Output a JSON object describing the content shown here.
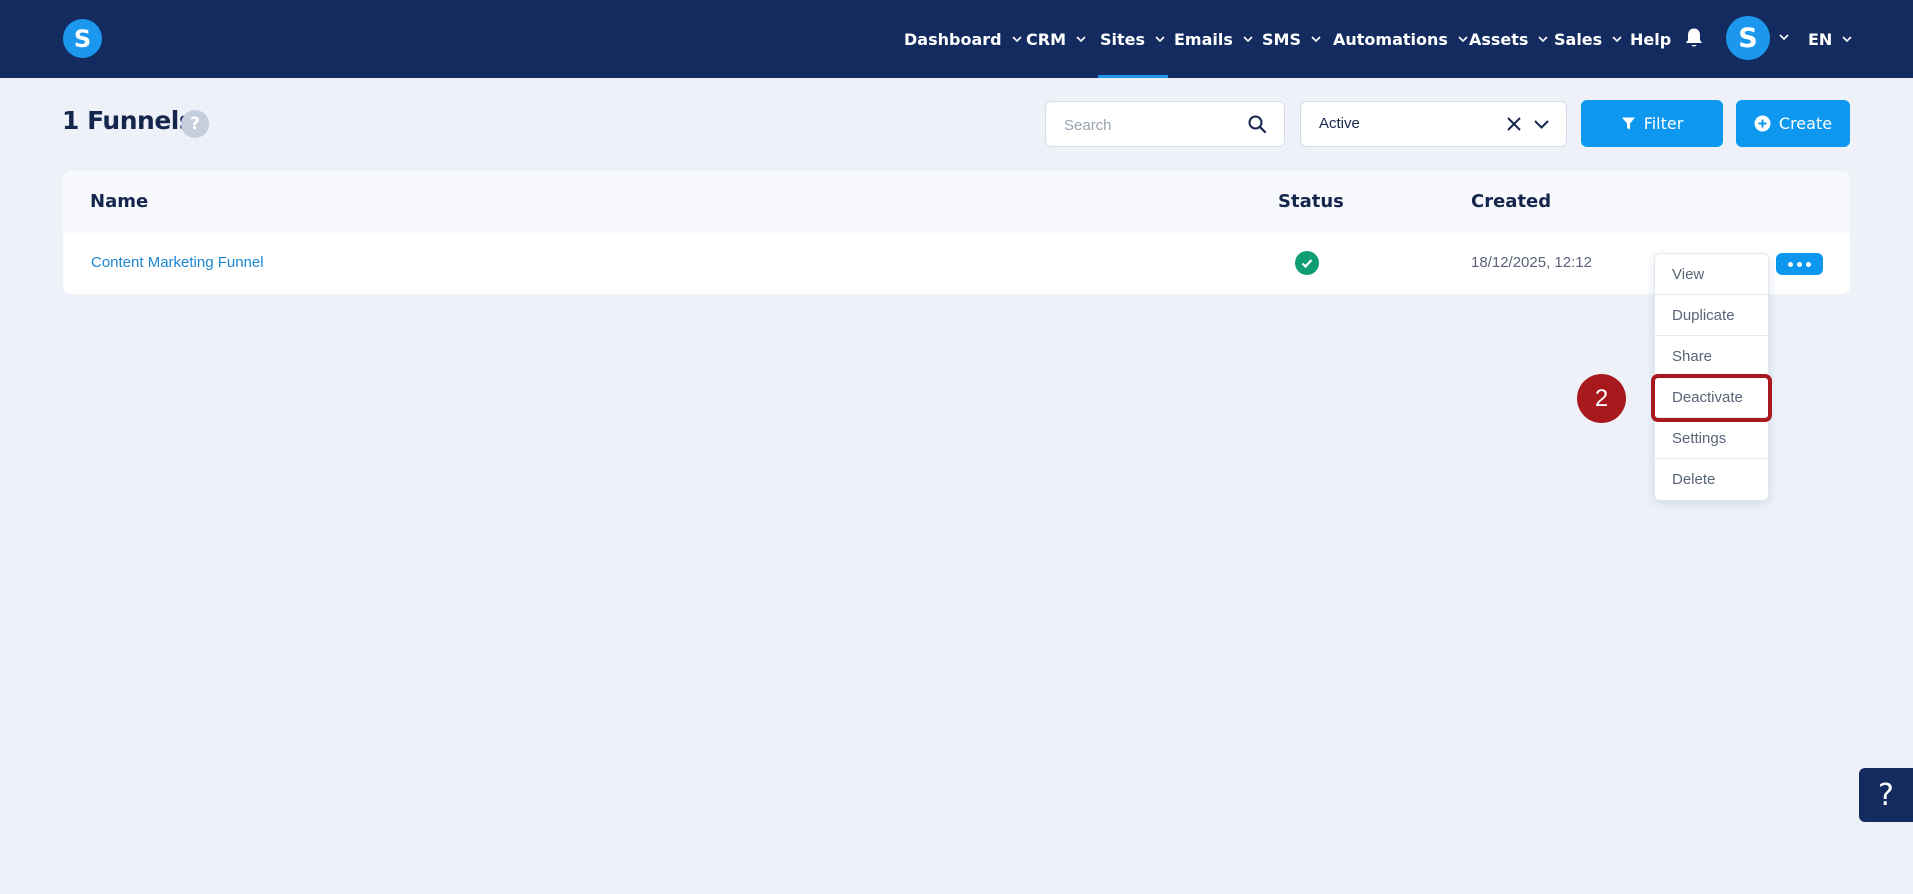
{
  "app": {
    "logo_letter": "S",
    "brand_color": "#1b98ee",
    "nav_bg": "#142b5f"
  },
  "nav": {
    "items": [
      {
        "label": "Dashboard",
        "has_dropdown": true
      },
      {
        "label": "CRM",
        "has_dropdown": true
      },
      {
        "label": "Sites",
        "has_dropdown": true,
        "active": true
      },
      {
        "label": "Emails",
        "has_dropdown": true
      },
      {
        "label": "SMS",
        "has_dropdown": true
      },
      {
        "label": "Automations",
        "has_dropdown": true
      },
      {
        "label": "Assets",
        "has_dropdown": true
      },
      {
        "label": "Sales",
        "has_dropdown": true
      },
      {
        "label": "Help",
        "has_dropdown": false
      }
    ],
    "bell_icon": "bell-icon",
    "avatar_letter": "S",
    "language": "EN"
  },
  "header": {
    "title": "1 Funnels",
    "help_symbol": "?",
    "search_placeholder": "Search",
    "status_filter_value": "Active",
    "filter_label": "Filter",
    "create_label": "Create"
  },
  "table": {
    "columns": {
      "name": "Name",
      "status": "Status",
      "created": "Created"
    },
    "rows": [
      {
        "name": "Content Marketing Funnel",
        "status": "active",
        "created": "18/12/2025, 12:12"
      }
    ]
  },
  "row_menu": {
    "items": [
      "View",
      "Duplicate",
      "Share",
      "Deactivate",
      "Settings",
      "Delete"
    ],
    "highlighted": "Deactivate",
    "step_number": "2",
    "highlight_color": "#a8191e"
  },
  "help_widget": {
    "symbol": "?"
  }
}
